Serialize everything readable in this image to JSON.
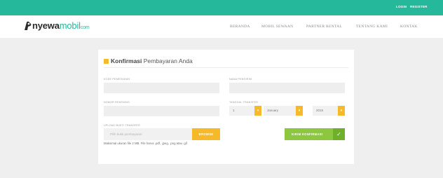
{
  "topbar": {
    "login": "LOGIN",
    "register": "REGISTER"
  },
  "brand": {
    "part1": "nyewa",
    "part2": "mobil",
    "suffix": "com"
  },
  "nav": [
    "BERANDA",
    "MOBIL SEWAAN",
    "PARTNER RENTAL",
    "TENTANG KAMI",
    "KONTAK"
  ],
  "form": {
    "title_bold": "Konfirmasi",
    "title_rest": " Pembayaran Anda",
    "kode_label": "KODE PEMESANAN",
    "kode_value": "",
    "nama_label": "NAMA PENGIRIM",
    "nama_value": "",
    "rekening_label": "NOMOR REKENING",
    "rekening_value": "",
    "tanggal_label": "TANGGAL TRANSFER",
    "day_value": "1",
    "month_value": "January",
    "year_value": "2015",
    "upload_label": "UPLOAD BUKTI TRANSFER",
    "upload_placeholder": "Pilih bukti pembayaran",
    "browse_label": "BROWSE",
    "hint": "Maksimal ukuran file 2 MB. File harus .pdf, .jpeg, .png atau .gif",
    "submit_label": "KIRIM KONFIRMASI"
  },
  "colors": {
    "green": "#26b89a",
    "yellow": "#f5b92a",
    "submit": "#8dc63f"
  },
  "icons": [
    "car-logo-icon",
    "form-title-icon",
    "chevron-down-icon",
    "checkmark-icon"
  ]
}
